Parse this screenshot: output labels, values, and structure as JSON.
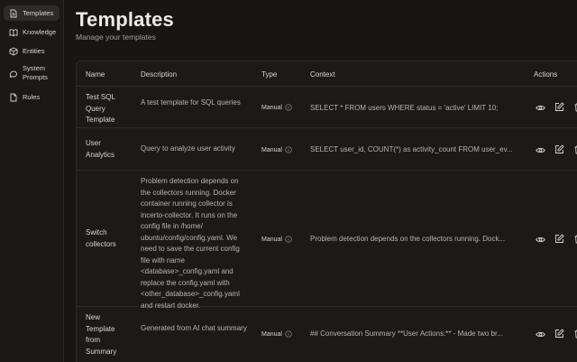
{
  "sidebar": {
    "items": [
      {
        "label": "Templates",
        "icon": "document-icon",
        "active": true
      },
      {
        "label": "Knowledge",
        "icon": "book-icon"
      },
      {
        "label": "Entities",
        "icon": "cube-icon"
      },
      {
        "label": "System Prompts",
        "icon": "chat-icon"
      },
      {
        "label": "Rules",
        "icon": "file-icon"
      }
    ]
  },
  "header": {
    "title": "Templates",
    "subtitle": "Manage your templates"
  },
  "table": {
    "columns": [
      "Name",
      "Description",
      "Type",
      "Context",
      "Actions"
    ],
    "rows": [
      {
        "name": "Test SQL Query Template",
        "description": "A test template for SQL queries",
        "type": "Manual",
        "context": "SELECT * FROM users WHERE status = 'active' LIMIT 10;"
      },
      {
        "name": "User Analytics",
        "description": "Query to analyze user activity",
        "type": "Manual",
        "context": "SELECT user_id, COUNT(*) as activity_count FROM user_ev..."
      },
      {
        "name": "Switch collectors",
        "description": "Problem detection depends on the collectors running. Docker container running collector is incerto-collector. It runs on the config file in /home/ ubuntu/config/config.yaml. We need to save the current config file with name <database>_config.yaml and replace the config.yaml with <other_database>_config.yaml and restart docker.",
        "type": "Manual",
        "context": "Problem detection depends on the collectors running. Dock..."
      },
      {
        "name": "New Template from Summary",
        "description": "Generated from AI chat summary",
        "type": "Manual",
        "context": "## Conversation Summary **User Actions:** - Made two br..."
      }
    ]
  }
}
